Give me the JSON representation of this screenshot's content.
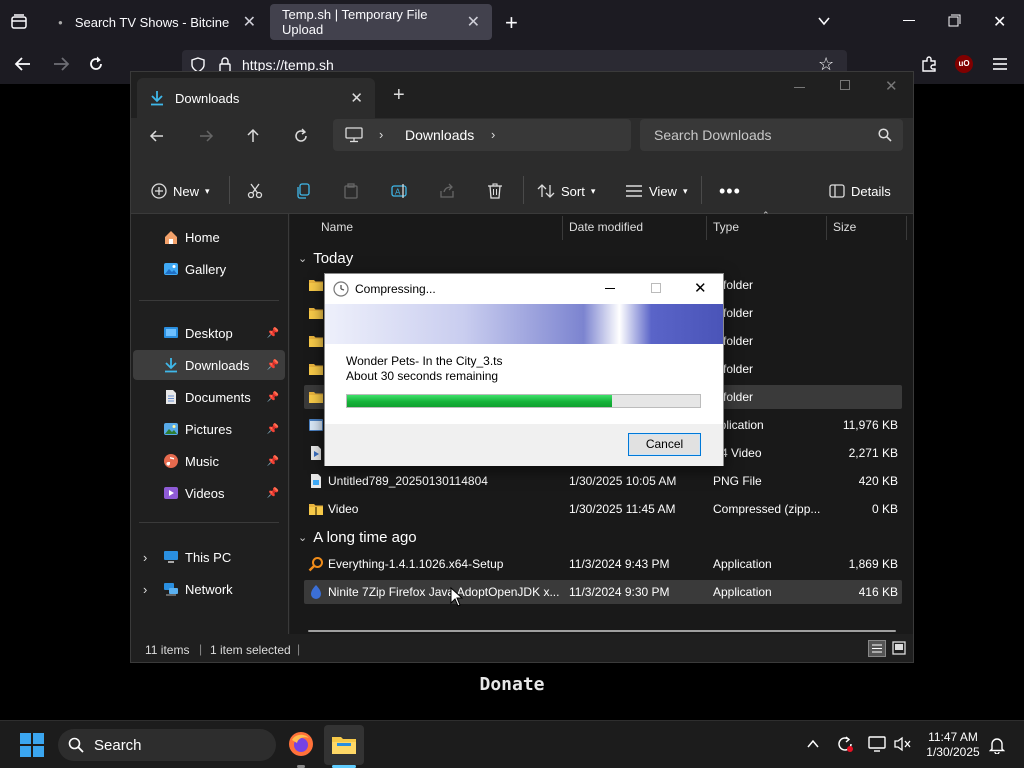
{
  "browser": {
    "tabs": [
      {
        "label": "Search TV Shows - Bitcine",
        "active": false
      },
      {
        "label": "Temp.sh | Temporary File Upload",
        "active": true
      }
    ],
    "url": "https://temp.sh"
  },
  "page": {
    "donate_label": "Donate"
  },
  "explorer": {
    "tab_title": "Downloads",
    "breadcrumb": [
      "Downloads"
    ],
    "search_placeholder": "Search Downloads",
    "commands": {
      "new": "New",
      "sort": "Sort",
      "view": "View",
      "details": "Details"
    },
    "sidebar": {
      "top": [
        {
          "label": "Home",
          "icon": "home-icon"
        },
        {
          "label": "Gallery",
          "icon": "gallery-icon"
        }
      ],
      "quick": [
        {
          "label": "Desktop",
          "icon": "desktop-icon",
          "pinned": true
        },
        {
          "label": "Downloads",
          "icon": "download-icon",
          "pinned": true,
          "selected": true
        },
        {
          "label": "Documents",
          "icon": "documents-icon",
          "pinned": true
        },
        {
          "label": "Pictures",
          "icon": "pictures-icon",
          "pinned": true
        },
        {
          "label": "Music",
          "icon": "music-icon",
          "pinned": true
        },
        {
          "label": "Videos",
          "icon": "videos-icon",
          "pinned": true
        }
      ],
      "bottom": [
        {
          "label": "This PC",
          "icon": "pc-icon"
        },
        {
          "label": "Network",
          "icon": "network-icon"
        }
      ]
    },
    "columns": {
      "name": "Name",
      "date": "Date modified",
      "type": "Type",
      "size": "Size"
    },
    "groups": [
      {
        "label": "Today",
        "rows": [
          {
            "name": "",
            "date": "",
            "type": "e folder",
            "size": "",
            "icon": "folder-icon"
          },
          {
            "name": "",
            "date": "",
            "type": "e folder",
            "size": "",
            "icon": "folder-icon"
          },
          {
            "name": "",
            "date": "",
            "type": "e folder",
            "size": "",
            "icon": "folder-icon"
          },
          {
            "name": "",
            "date": "",
            "type": "e folder",
            "size": "",
            "icon": "folder-icon"
          },
          {
            "name": "",
            "date": "",
            "type": "e folder",
            "size": "",
            "icon": "folder-icon",
            "highlight": true
          },
          {
            "name": "",
            "date": "",
            "type": "pplication",
            "size": "11,976 KB",
            "icon": "app-icon"
          },
          {
            "name": "",
            "date": "",
            "type": "P4 Video",
            "size": "2,271 KB",
            "icon": "video-file-icon"
          },
          {
            "name": "Untitled789_20250130114804",
            "date": "1/30/2025 10:05 AM",
            "type": "PNG File",
            "size": "420 KB",
            "icon": "image-file-icon"
          },
          {
            "name": "Video",
            "date": "1/30/2025 11:45 AM",
            "type": "Compressed (zipp...",
            "size": "0 KB",
            "icon": "zip-folder-icon"
          }
        ]
      },
      {
        "label": "A long time ago",
        "rows": [
          {
            "name": "Everything-1.4.1.1026.x64-Setup",
            "date": "11/3/2024 9:43 PM",
            "type": "Application",
            "size": "1,869 KB",
            "icon": "magnifier-app-icon"
          },
          {
            "name": "Ninite 7Zip Firefox Java AdoptOpenJDK x...",
            "date": "11/3/2024 9:30 PM",
            "type": "Application",
            "size": "416 KB",
            "icon": "ninite-icon",
            "selected": true
          }
        ]
      }
    ],
    "status": {
      "items": "11 items",
      "selected": "1 item selected"
    }
  },
  "dialog": {
    "title": "Compressing...",
    "filename": "Wonder Pets- In the City_3.ts",
    "remaining": "About 30 seconds remaining",
    "progress_fraction": 0.75,
    "cancel_label": "Cancel"
  },
  "taskbar": {
    "search_label": "Search",
    "time": "11:47 AM",
    "date": "1/30/2025"
  },
  "colors": {
    "accent": "#0078d4",
    "progress": "#16b33a",
    "firefox_bg": "#1c1b22"
  }
}
